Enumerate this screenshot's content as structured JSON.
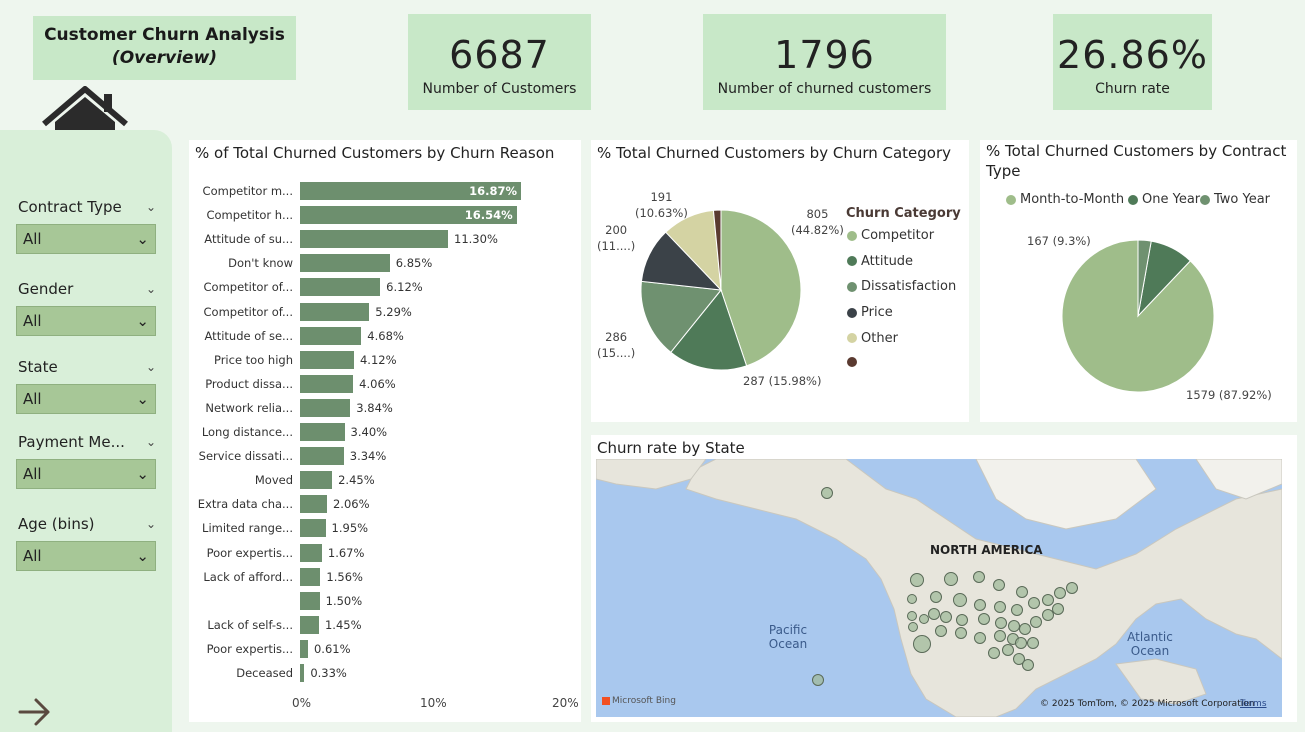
{
  "header": {
    "title_line1": "Customer Churn Analysis",
    "title_line2": "(Overview)"
  },
  "kpis": [
    {
      "value": "6687",
      "label": "Number of Customers"
    },
    {
      "value": "1796",
      "label": "Number of churned customers"
    },
    {
      "value": "26.86%",
      "label": "Churn rate"
    }
  ],
  "filters": [
    {
      "label": "Contract Type",
      "value": "All"
    },
    {
      "label": "Gender",
      "value": "All"
    },
    {
      "label": "State",
      "value": "All"
    },
    {
      "label": "Payment Me...",
      "value": "All"
    },
    {
      "label": "Age (bins)",
      "value": "All"
    }
  ],
  "icons": {
    "home": "home-icon",
    "next": "arrow-right-icon",
    "dropdown": "chevron-down-icon"
  },
  "colors": {
    "bar": "#6d8f6e",
    "competitor": "#9fbd8a",
    "attitude": "#4f7a58",
    "dissatisfaction": "#6f9170",
    "price": "#3b4248",
    "other": "#d4d3a3",
    "unlabeled": "#5a3a30",
    "month_to_month": "#9fbd8a",
    "one_year": "#4f7a58",
    "two_year": "#6f9170"
  },
  "charts": {
    "reason": {
      "title": "% of Total Churned Customers by Churn Reason",
      "ticks": [
        "0%",
        "10%",
        "20%"
      ]
    },
    "category": {
      "title": "% Total Churned Customers by Churn Category",
      "legend_title": "Churn Category",
      "labels": [
        {
          "v": "805",
          "p": "(44.82%)"
        },
        {
          "v": "287 (15.98%)",
          "p": ""
        },
        {
          "v": "286",
          "p": "(15....)"
        },
        {
          "v": "200",
          "p": "(11....)"
        },
        {
          "v": "191",
          "p": "(10.63%)"
        }
      ]
    },
    "contract": {
      "title": "% Total Churned Customers by Contract Type",
      "labels": [
        "167 (9.3%)",
        "1579 (87.92%)"
      ]
    },
    "state": {
      "title": "Churn rate by State",
      "continent": "NORTH AMERICA",
      "pacific": "Pacific Ocean",
      "atlantic": "Atlantic Ocean",
      "bing": "Microsoft Bing",
      "copyright": "© 2025 TomTom, © 2025 Microsoft Corporation",
      "terms": "Terms"
    }
  },
  "chart_data": [
    {
      "type": "bar",
      "title": "% of Total Churned Customers by Churn Reason",
      "orientation": "horizontal",
      "xlim": [
        0,
        20
      ],
      "categories": [
        "Competitor m...",
        "Competitor h...",
        "Attitude of su...",
        "Don't know",
        "Competitor of...",
        "Competitor of...",
        "Attitude of se...",
        "Price too high",
        "Product dissa...",
        "Network relia...",
        "Long distance...",
        "Service dissati...",
        "Moved",
        "Extra data cha...",
        "Limited range...",
        "Poor expertis...",
        "Lack of afford...",
        "",
        "Lack of self-s...",
        "Poor expertis...",
        "Deceased"
      ],
      "values": [
        16.87,
        16.54,
        11.3,
        6.85,
        6.12,
        5.29,
        4.68,
        4.12,
        4.06,
        3.84,
        3.4,
        3.34,
        2.45,
        2.06,
        1.95,
        1.67,
        1.56,
        1.5,
        1.45,
        0.61,
        0.33
      ],
      "value_labels": [
        "16.87%",
        "16.54%",
        "11.30%",
        "6.85%",
        "6.12%",
        "5.29%",
        "4.68%",
        "4.12%",
        "4.06%",
        "3.84%",
        "3.40%",
        "3.34%",
        "2.45%",
        "2.06%",
        "1.95%",
        "1.67%",
        "1.56%",
        "1.50%",
        "1.45%",
        "0.61%",
        "0.33%"
      ]
    },
    {
      "type": "pie",
      "title": "% Total Churned Customers by Churn Category",
      "legend_title": "Churn Category",
      "slices": [
        {
          "name": "Competitor",
          "value": 805,
          "percent": 44.82
        },
        {
          "name": "Attitude",
          "value": 287,
          "percent": 15.98
        },
        {
          "name": "Dissatisfaction",
          "value": 286,
          "percent": 15.9
        },
        {
          "name": "Price",
          "value": 200,
          "percent": 11.1
        },
        {
          "name": "Other",
          "value": 191,
          "percent": 10.63
        },
        {
          "name": "",
          "value": 27,
          "percent": 1.5
        }
      ]
    },
    {
      "type": "pie",
      "title": "% Total Churned Customers by Contract Type",
      "slices": [
        {
          "name": "Month-to-Month",
          "value": 1579,
          "percent": 87.92
        },
        {
          "name": "One Year",
          "value": 167,
          "percent": 9.3
        },
        {
          "name": "Two Year",
          "value": 50,
          "percent": 2.78
        }
      ]
    }
  ]
}
